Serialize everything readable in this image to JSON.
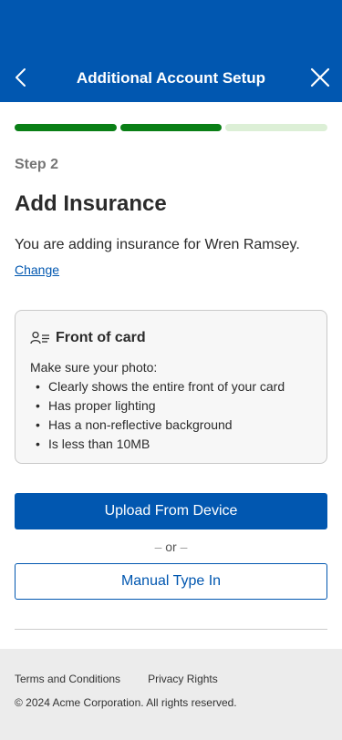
{
  "header": {
    "title": "Additional Account Setup",
    "back_icon": "chevron-left-icon",
    "close_icon": "close-icon",
    "background_color": "#0157b0"
  },
  "progress": {
    "current_step": 2,
    "total_steps": 3,
    "complete_color": "#0a7f16",
    "incomplete_color": "#dcefd6"
  },
  "step_label": "Step 2",
  "title": "Add Insurance",
  "description": "You are adding insurance for Wren Ramsey.",
  "change_link": "Change",
  "card": {
    "icon": "person-list-icon",
    "title": "Front of card",
    "intro": "Make sure your photo:",
    "requirements": [
      "Clearly shows the entire front of your card",
      "Has proper lighting",
      "Has a non-reflective background",
      "Is less than 10MB"
    ]
  },
  "upload_button": "Upload From Device",
  "separator": {
    "dash": "–",
    "text": "or"
  },
  "manual_button": "Manual Type In",
  "footer": {
    "terms": "Terms and Conditions",
    "privacy": "Privacy Rights",
    "copyright": "© 2024 Acme Corporation. All rights reserved."
  }
}
